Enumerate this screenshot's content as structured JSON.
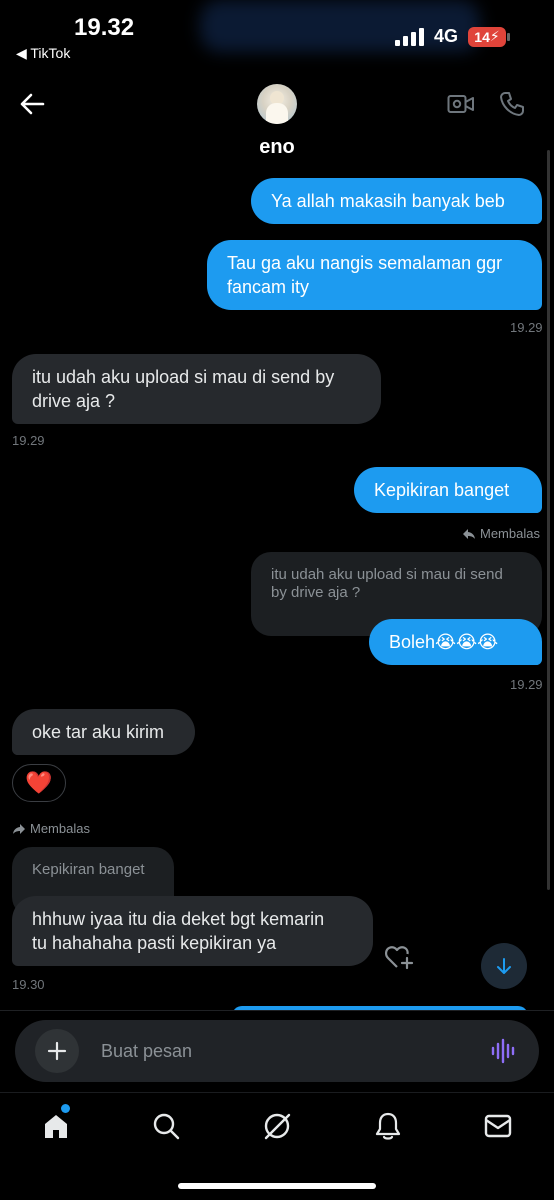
{
  "status_bar": {
    "time": "19.32",
    "back_app": "◀ TikTok",
    "network": "4G",
    "battery": "14"
  },
  "header": {
    "contact_name": "eno"
  },
  "messages": {
    "m1": "Ya allah makasih banyak beb",
    "m2_line1": "Tau ga aku nangis semalaman ggr",
    "m2_line2": "fancam ity",
    "ts1": "19.29",
    "m3_line1": "itu udah aku upload si mau di send by",
    "m3_line2": "drive aja ?",
    "ts2": "19.29",
    "m4": "Kepikiran banget",
    "reply_label_out": "Membalas",
    "quote_out_line1": "itu udah aku upload si mau di send",
    "quote_out_line2": "by drive aja ?",
    "m5": "Boleh😭😭😭",
    "ts3": "19.29",
    "m6": "oke tar aku kirim",
    "reaction": "❤️",
    "reply_label_in": "Membalas",
    "quote_in": "Kepikiran banget",
    "m7_line1": "hhhuw iyaa itu dia deket bgt kemarin",
    "m7_line2": "tu hahahaha pasti kepikiran ya",
    "ts4": "19.30"
  },
  "composer": {
    "placeholder": "Buat pesan"
  },
  "colors": {
    "accent": "#1d9bf0",
    "incoming": "#26292d",
    "background": "#000000"
  },
  "icons": {
    "header": [
      "back-arrow-icon",
      "video-call-icon",
      "phone-icon"
    ],
    "tabs": [
      "home-icon",
      "search-icon",
      "grok-icon",
      "notifications-icon",
      "messages-icon"
    ]
  }
}
